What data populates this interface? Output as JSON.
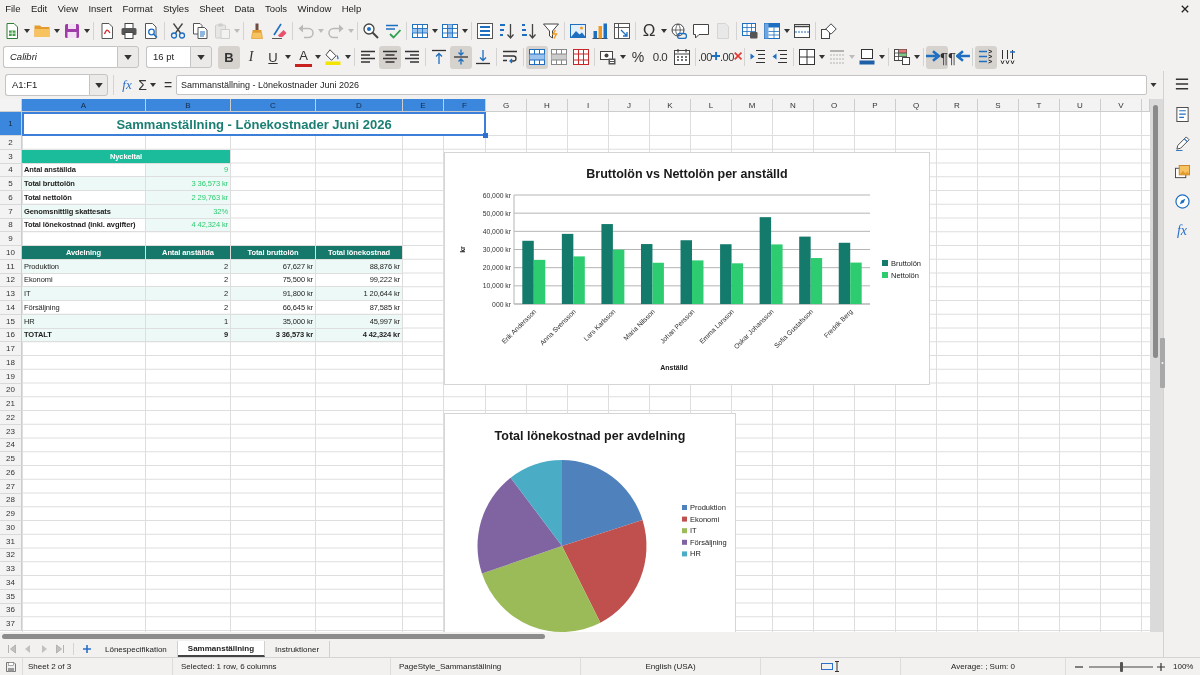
{
  "menu_bar": [
    "File",
    "Edit",
    "View",
    "Insert",
    "Format",
    "Styles",
    "Sheet",
    "Data",
    "Tools",
    "Window",
    "Help"
  ],
  "standard_toolbar": [
    {
      "kind": "new",
      "disabled": false
    },
    {
      "kind": "open",
      "disabled": false
    },
    {
      "kind": "save",
      "disabled": false
    },
    {
      "kind": "export-pdf",
      "disabled": false
    },
    {
      "kind": "print",
      "disabled": false
    },
    {
      "kind": "print-preview",
      "disabled": false
    },
    {
      "kind": "cut",
      "disabled": false
    },
    {
      "kind": "copy",
      "disabled": false
    },
    {
      "kind": "paste",
      "disabled": true
    },
    {
      "kind": "clone-formatting",
      "disabled": false
    },
    {
      "kind": "clear-formatting",
      "disabled": false
    },
    {
      "kind": "undo",
      "disabled": true
    },
    {
      "kind": "redo",
      "disabled": true
    },
    {
      "kind": "find-replace",
      "disabled": false
    },
    {
      "kind": "spelling",
      "disabled": false
    },
    {
      "kind": "rows",
      "disabled": false
    },
    {
      "kind": "columns",
      "disabled": false
    },
    {
      "kind": "sort",
      "disabled": false
    },
    {
      "kind": "sort-ascending",
      "disabled": false
    },
    {
      "kind": "sort-descending",
      "disabled": false
    },
    {
      "kind": "autofilter",
      "disabled": false
    },
    {
      "kind": "image",
      "disabled": false
    },
    {
      "kind": "chart",
      "disabled": false
    },
    {
      "kind": "pivot-table",
      "disabled": false
    },
    {
      "kind": "special-character",
      "label": "Ω",
      "disabled": false
    },
    {
      "kind": "hyperlink",
      "disabled": false
    },
    {
      "kind": "comment",
      "disabled": false
    },
    {
      "kind": "header-footer",
      "disabled": true
    },
    {
      "kind": "print-area",
      "disabled": false
    },
    {
      "kind": "freeze",
      "disabled": false
    },
    {
      "kind": "split-window",
      "disabled": false
    },
    {
      "kind": "draw-functions",
      "disabled": false
    }
  ],
  "formatting_toolbar": {
    "font_name": "Calibri",
    "font_substituted": true,
    "font_size": "16 pt",
    "buttons": [
      {
        "kind": "bold",
        "label": "B",
        "on": true,
        "disabled": false
      },
      {
        "kind": "italic",
        "label": "I",
        "on": false,
        "disabled": false
      },
      {
        "kind": "underline",
        "label": "U",
        "on": false,
        "disabled": false
      },
      {
        "kind": "font-color",
        "label": "A",
        "on": false,
        "disabled": false
      },
      {
        "kind": "highlight",
        "on": false,
        "disabled": false
      },
      {
        "kind": "align-left",
        "on": false,
        "disabled": false
      },
      {
        "kind": "align-center",
        "on": true,
        "disabled": false
      },
      {
        "kind": "align-right",
        "on": false,
        "disabled": false
      },
      {
        "kind": "align-top",
        "on": false,
        "disabled": false
      },
      {
        "kind": "align-middle",
        "on": true,
        "disabled": false
      },
      {
        "kind": "align-bottom",
        "on": false,
        "disabled": false
      },
      {
        "kind": "wrap-text",
        "on": false,
        "disabled": false
      },
      {
        "kind": "merge-center",
        "on": true,
        "disabled": false
      },
      {
        "kind": "merge",
        "on": false,
        "disabled": false
      },
      {
        "kind": "unmerge",
        "on": false,
        "disabled": false
      },
      {
        "kind": "currency-format",
        "on": false,
        "disabled": false
      },
      {
        "kind": "percent-format",
        "label": "%",
        "on": false,
        "disabled": false
      },
      {
        "kind": "number-format",
        "label": "0.0",
        "on": false,
        "disabled": false
      },
      {
        "kind": "date-format",
        "on": false,
        "disabled": false
      },
      {
        "kind": "add-decimal",
        "label": ".00",
        "on": false,
        "disabled": false
      },
      {
        "kind": "delete-decimal",
        "label": ".00",
        "on": false,
        "disabled": false
      },
      {
        "kind": "increase-indent",
        "on": false,
        "disabled": false
      },
      {
        "kind": "decrease-indent",
        "on": false,
        "disabled": false
      },
      {
        "kind": "borders",
        "on": false,
        "disabled": false
      },
      {
        "kind": "border-style",
        "on": false,
        "disabled": true
      },
      {
        "kind": "border-color",
        "on": false,
        "disabled": false
      },
      {
        "kind": "conditional-format",
        "on": false,
        "disabled": false
      },
      {
        "kind": "left-to-right",
        "label": "¶",
        "on": true,
        "disabled": false
      },
      {
        "kind": "right-to-left",
        "label": "¶",
        "on": false,
        "disabled": false
      },
      {
        "kind": "text-horizontal",
        "on": true,
        "disabled": false
      },
      {
        "kind": "text-vertical",
        "on": false,
        "disabled": false
      }
    ]
  },
  "formula_bar": {
    "name_box": "A1:F1",
    "function_wizard": "fx",
    "sum": "Σ",
    "formula": "=",
    "content": "Sammanställning - Lönekostnader Juni 2026"
  },
  "sheet": {
    "columns": [
      {
        "label": "A",
        "selected": true
      },
      {
        "label": "B",
        "selected": true
      },
      {
        "label": "C",
        "selected": true
      },
      {
        "label": "D",
        "selected": true
      },
      {
        "label": "E",
        "selected": true
      },
      {
        "label": "F",
        "selected": true
      },
      {
        "label": "G",
        "selected": false
      },
      {
        "label": "H",
        "selected": false
      },
      {
        "label": "I",
        "selected": false
      },
      {
        "label": "J",
        "selected": false
      },
      {
        "label": "K",
        "selected": false
      },
      {
        "label": "L",
        "selected": false
      },
      {
        "label": "M",
        "selected": false
      },
      {
        "label": "N",
        "selected": false
      },
      {
        "label": "O",
        "selected": false
      },
      {
        "label": "P",
        "selected": false
      },
      {
        "label": "Q",
        "selected": false
      },
      {
        "label": "R",
        "selected": false
      },
      {
        "label": "S",
        "selected": false
      },
      {
        "label": "T",
        "selected": false
      },
      {
        "label": "U",
        "selected": false
      },
      {
        "label": "V",
        "selected": false
      }
    ],
    "rows": [
      {
        "label": "1",
        "selected": true
      },
      {
        "label": "2",
        "selected": false
      },
      {
        "label": "3",
        "selected": false
      },
      {
        "label": "4",
        "selected": false
      },
      {
        "label": "5",
        "selected": false
      },
      {
        "label": "6",
        "selected": false
      },
      {
        "label": "7",
        "selected": false
      },
      {
        "label": "8",
        "selected": false
      },
      {
        "label": "9",
        "selected": false
      },
      {
        "label": "10",
        "selected": false
      },
      {
        "label": "11",
        "selected": false
      },
      {
        "label": "12",
        "selected": false
      },
      {
        "label": "13",
        "selected": false
      },
      {
        "label": "14",
        "selected": false
      },
      {
        "label": "15",
        "selected": false
      },
      {
        "label": "16",
        "selected": false
      },
      {
        "label": "17",
        "selected": false
      },
      {
        "label": "18",
        "selected": false
      },
      {
        "label": "19",
        "selected": false
      },
      {
        "label": "20",
        "selected": false
      },
      {
        "label": "21",
        "selected": false
      },
      {
        "label": "22",
        "selected": false
      },
      {
        "label": "23",
        "selected": false
      },
      {
        "label": "24",
        "selected": false
      },
      {
        "label": "25",
        "selected": false
      },
      {
        "label": "26",
        "selected": false
      },
      {
        "label": "27",
        "selected": false
      },
      {
        "label": "28",
        "selected": false
      },
      {
        "label": "29",
        "selected": false
      },
      {
        "label": "30",
        "selected": false
      },
      {
        "label": "31",
        "selected": false
      },
      {
        "label": "32",
        "selected": false
      },
      {
        "label": "33",
        "selected": false
      },
      {
        "label": "34",
        "selected": false
      },
      {
        "label": "35",
        "selected": false
      },
      {
        "label": "36",
        "selected": false
      },
      {
        "label": "37",
        "selected": false
      }
    ],
    "title": {
      "text": "Sammanställning - Lönekostnader Juni 2026",
      "selected": true
    },
    "key_figures": {
      "heading": "Nyckeltal",
      "rows": [
        {
          "label": "Antal anställda",
          "value": "9"
        },
        {
          "label": "Total bruttolön",
          "value": "3 36,573 kr"
        },
        {
          "label": "Total nettolön",
          "value": "2 29,763 kr"
        },
        {
          "label": "Genomsnittlig skattesats",
          "value": "32%"
        },
        {
          "label": "Total lönekostnad (inkl. avgifter)",
          "value": "4 42,324 kr"
        }
      ]
    },
    "department_table": {
      "columns": [
        "Avdelning",
        "Antal anställda",
        "Total bruttolön",
        "Total lönekostnad"
      ],
      "rows": [
        [
          "Produktion",
          "2",
          "67,627 kr",
          "88,876 kr"
        ],
        [
          "Ekonomi",
          "2",
          "75,500 kr",
          "99,222 kr"
        ],
        [
          "IT",
          "2",
          "91,800 kr",
          "1 20,644 kr"
        ],
        [
          "Försäljning",
          "2",
          "66,645 kr",
          "87,585 kr"
        ],
        [
          "HR",
          "1",
          "35,000 kr",
          "45,997 kr"
        ]
      ],
      "total": [
        "TOTALT",
        "9",
        "3 36,573 kr",
        "4 42,324 kr"
      ]
    },
    "charts": [
      {
        "chart_data": {
          "type": "bar",
          "title": "Bruttolön vs Nettolön per anställd",
          "xlabel": "Anställd",
          "ylabel": "kr",
          "categories": [
            "Erik Andersson",
            "Anna Svensson",
            "Lars Karlsson",
            "Maria Nilsson",
            "Johan Persson",
            "Emma Larsson",
            "Oskar Johansson",
            "Sofia Gustafsson",
            "Fredrik Berg"
          ],
          "series": [
            {
              "name": "Bruttolön",
              "color": "#147a6c",
              "values": [
                34800,
                38600,
                44000,
                33000,
                35100,
                32900,
                47800,
                37100,
                33700
              ]
            },
            {
              "name": "Nettolön",
              "color": "#2ecc71",
              "values": [
                24300,
                26200,
                29900,
                22700,
                24000,
                22400,
                32800,
                25300,
                22800
              ]
            }
          ],
          "ylim": [
            0,
            60000
          ],
          "yticks": [
            {
              "value": 0,
              "label": "000 kr"
            },
            {
              "value": 10000,
              "label": "10,000 kr"
            },
            {
              "value": 20000,
              "label": "20,000 kr"
            },
            {
              "value": 30000,
              "label": "30,000 kr"
            },
            {
              "value": 40000,
              "label": "40,000 kr"
            },
            {
              "value": 50000,
              "label": "50,000 kr"
            },
            {
              "value": 60000,
              "label": "60,000 kr"
            }
          ],
          "grid": true,
          "legend": "right"
        }
      },
      {
        "chart_data": {
          "type": "pie",
          "title": "Total lönekostnad per avdelning",
          "categories": [
            "Produktion",
            "Ekonomi",
            "IT",
            "Försäljning",
            "HR"
          ],
          "values": [
            20.1,
            22.4,
            27.3,
            19.8,
            10.4
          ],
          "colors": [
            "#4f81bd",
            "#c0504d",
            "#9bbb59",
            "#8064a2",
            "#4bacc6"
          ],
          "legend": "right"
        }
      }
    ]
  },
  "sidebar": {
    "functions": "fx"
  },
  "sheet_bar": {
    "navigation_disabled": true,
    "tabs": [
      {
        "label": "Lönespecifikation",
        "selected": false
      },
      {
        "label": "Sammanställning",
        "selected": true
      },
      {
        "label": "Instruktioner",
        "selected": false
      }
    ]
  },
  "status_bar": {
    "sheet": "Sheet 2 of 3",
    "selection": "Selected: 1 row, 6 columns",
    "page_style": "PageStyle_Sammanställning",
    "language": "English (USA)",
    "summary": "Average: ; Sum: 0",
    "zoom": {
      "level": 0.5,
      "reading": "100%"
    }
  }
}
